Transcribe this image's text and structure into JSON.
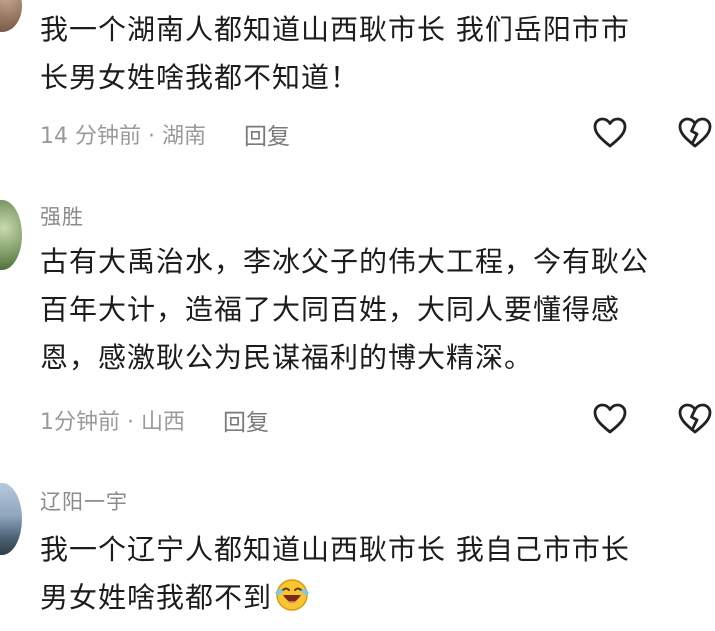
{
  "comments": [
    {
      "username": "",
      "text_line1": "我一个湖南人都知道山西耿市长  我们岳阳市市",
      "text_line2": "长男女姓啥我都不知道！",
      "time": "14 分钟前 · 湖南",
      "reply": "回复"
    },
    {
      "username": "强胜",
      "text_line1": "古有大禹治水，李冰父子的伟大工程，今有耿公",
      "text_line2": "百年大计，造福了大同百姓，大同人要懂得感",
      "text_line3": "恩，感激耿公为民谋福利的博大精深。",
      "time": "1分钟前 · 山西",
      "reply": "回复"
    },
    {
      "username": "辽阳一宇",
      "text_line1": "我一个辽宁人都知道山西耿市长  我自己市市长",
      "text_line2": "男女姓啥我都不到",
      "emoji": "laughing-crying-emoji"
    }
  ],
  "icons": {
    "like": "heart-outline-icon",
    "dislike": "broken-heart-outline-icon"
  },
  "colors": {
    "text": "#1c1c1c",
    "meta": "#9a9a9a",
    "username": "#8b8b8b",
    "icon_stroke": "#222222"
  }
}
